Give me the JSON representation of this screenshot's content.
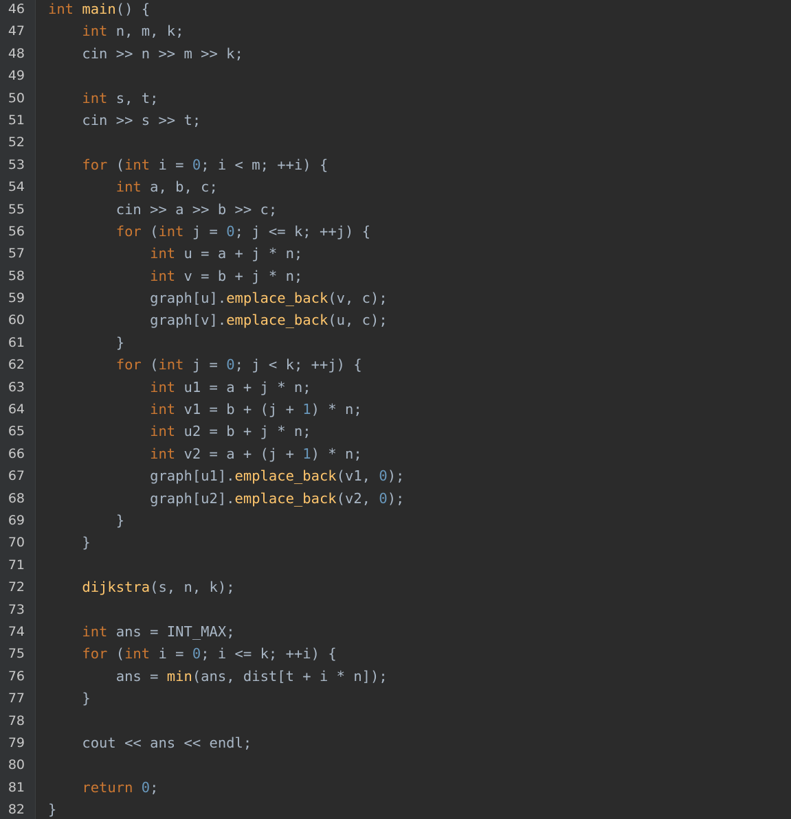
{
  "colors": {
    "background": "#2b2b2b",
    "keyword": "#cc7832",
    "function": "#ffc66d",
    "number": "#6897bb",
    "text": "#a9b7c6",
    "line_number": "#c8c8c8"
  },
  "lines": [
    {
      "n": "46",
      "tokens": [
        {
          "t": "int",
          "c": "kw"
        },
        {
          "t": " ",
          "c": "plain"
        },
        {
          "t": "main",
          "c": "fn"
        },
        {
          "t": "() {",
          "c": "plain"
        }
      ]
    },
    {
      "n": "47",
      "tokens": [
        {
          "t": "    ",
          "c": "plain"
        },
        {
          "t": "int",
          "c": "kw"
        },
        {
          "t": " n, m, k;",
          "c": "plain"
        }
      ]
    },
    {
      "n": "48",
      "tokens": [
        {
          "t": "    cin >> n >> m >> k;",
          "c": "plain"
        }
      ]
    },
    {
      "n": "49",
      "tokens": []
    },
    {
      "n": "50",
      "tokens": [
        {
          "t": "    ",
          "c": "plain"
        },
        {
          "t": "int",
          "c": "kw"
        },
        {
          "t": " s, t;",
          "c": "plain"
        }
      ]
    },
    {
      "n": "51",
      "tokens": [
        {
          "t": "    cin >> s >> t;",
          "c": "plain"
        }
      ]
    },
    {
      "n": "52",
      "tokens": []
    },
    {
      "n": "53",
      "tokens": [
        {
          "t": "    ",
          "c": "plain"
        },
        {
          "t": "for",
          "c": "kw"
        },
        {
          "t": " (",
          "c": "plain"
        },
        {
          "t": "int",
          "c": "kw"
        },
        {
          "t": " i = ",
          "c": "plain"
        },
        {
          "t": "0",
          "c": "num"
        },
        {
          "t": "; i < m; ++i) {",
          "c": "plain"
        }
      ]
    },
    {
      "n": "54",
      "tokens": [
        {
          "t": "        ",
          "c": "plain"
        },
        {
          "t": "int",
          "c": "kw"
        },
        {
          "t": " a, b, c;",
          "c": "plain"
        }
      ]
    },
    {
      "n": "55",
      "tokens": [
        {
          "t": "        cin >> a >> b >> c;",
          "c": "plain"
        }
      ]
    },
    {
      "n": "56",
      "tokens": [
        {
          "t": "        ",
          "c": "plain"
        },
        {
          "t": "for",
          "c": "kw"
        },
        {
          "t": " (",
          "c": "plain"
        },
        {
          "t": "int",
          "c": "kw"
        },
        {
          "t": " j = ",
          "c": "plain"
        },
        {
          "t": "0",
          "c": "num"
        },
        {
          "t": "; j <= k; ++j) {",
          "c": "plain"
        }
      ]
    },
    {
      "n": "57",
      "tokens": [
        {
          "t": "            ",
          "c": "plain"
        },
        {
          "t": "int",
          "c": "kw"
        },
        {
          "t": " u = a + j * n;",
          "c": "plain"
        }
      ]
    },
    {
      "n": "58",
      "tokens": [
        {
          "t": "            ",
          "c": "plain"
        },
        {
          "t": "int",
          "c": "kw"
        },
        {
          "t": " v = b + j * n;",
          "c": "plain"
        }
      ]
    },
    {
      "n": "59",
      "tokens": [
        {
          "t": "            graph[u].",
          "c": "plain"
        },
        {
          "t": "emplace_back",
          "c": "fn"
        },
        {
          "t": "(v, c);",
          "c": "plain"
        }
      ]
    },
    {
      "n": "60",
      "tokens": [
        {
          "t": "            graph[v].",
          "c": "plain"
        },
        {
          "t": "emplace_back",
          "c": "fn"
        },
        {
          "t": "(u, c);",
          "c": "plain"
        }
      ]
    },
    {
      "n": "61",
      "tokens": [
        {
          "t": "        }",
          "c": "plain"
        }
      ]
    },
    {
      "n": "62",
      "tokens": [
        {
          "t": "        ",
          "c": "plain"
        },
        {
          "t": "for",
          "c": "kw"
        },
        {
          "t": " (",
          "c": "plain"
        },
        {
          "t": "int",
          "c": "kw"
        },
        {
          "t": " j = ",
          "c": "plain"
        },
        {
          "t": "0",
          "c": "num"
        },
        {
          "t": "; j < k; ++j) {",
          "c": "plain"
        }
      ]
    },
    {
      "n": "63",
      "tokens": [
        {
          "t": "            ",
          "c": "plain"
        },
        {
          "t": "int",
          "c": "kw"
        },
        {
          "t": " u1 = a + j * n;",
          "c": "plain"
        }
      ]
    },
    {
      "n": "64",
      "tokens": [
        {
          "t": "            ",
          "c": "plain"
        },
        {
          "t": "int",
          "c": "kw"
        },
        {
          "t": " v1 = b + (j + ",
          "c": "plain"
        },
        {
          "t": "1",
          "c": "num"
        },
        {
          "t": ") * n;",
          "c": "plain"
        }
      ]
    },
    {
      "n": "65",
      "tokens": [
        {
          "t": "            ",
          "c": "plain"
        },
        {
          "t": "int",
          "c": "kw"
        },
        {
          "t": " u2 = b + j * n;",
          "c": "plain"
        }
      ]
    },
    {
      "n": "66",
      "tokens": [
        {
          "t": "            ",
          "c": "plain"
        },
        {
          "t": "int",
          "c": "kw"
        },
        {
          "t": " v2 = a + (j + ",
          "c": "plain"
        },
        {
          "t": "1",
          "c": "num"
        },
        {
          "t": ") * n;",
          "c": "plain"
        }
      ]
    },
    {
      "n": "67",
      "tokens": [
        {
          "t": "            graph[u1].",
          "c": "plain"
        },
        {
          "t": "emplace_back",
          "c": "fn"
        },
        {
          "t": "(v1, ",
          "c": "plain"
        },
        {
          "t": "0",
          "c": "num"
        },
        {
          "t": ");",
          "c": "plain"
        }
      ]
    },
    {
      "n": "68",
      "tokens": [
        {
          "t": "            graph[u2].",
          "c": "plain"
        },
        {
          "t": "emplace_back",
          "c": "fn"
        },
        {
          "t": "(v2, ",
          "c": "plain"
        },
        {
          "t": "0",
          "c": "num"
        },
        {
          "t": ");",
          "c": "plain"
        }
      ]
    },
    {
      "n": "69",
      "tokens": [
        {
          "t": "        }",
          "c": "plain"
        }
      ]
    },
    {
      "n": "70",
      "tokens": [
        {
          "t": "    }",
          "c": "plain"
        }
      ]
    },
    {
      "n": "71",
      "tokens": []
    },
    {
      "n": "72",
      "tokens": [
        {
          "t": "    ",
          "c": "plain"
        },
        {
          "t": "dijkstra",
          "c": "fn"
        },
        {
          "t": "(s, n, k);",
          "c": "plain"
        }
      ]
    },
    {
      "n": "73",
      "tokens": []
    },
    {
      "n": "74",
      "tokens": [
        {
          "t": "    ",
          "c": "plain"
        },
        {
          "t": "int",
          "c": "kw"
        },
        {
          "t": " ans = INT_MAX;",
          "c": "plain"
        }
      ]
    },
    {
      "n": "75",
      "tokens": [
        {
          "t": "    ",
          "c": "plain"
        },
        {
          "t": "for",
          "c": "kw"
        },
        {
          "t": " (",
          "c": "plain"
        },
        {
          "t": "int",
          "c": "kw"
        },
        {
          "t": " i = ",
          "c": "plain"
        },
        {
          "t": "0",
          "c": "num"
        },
        {
          "t": "; i <= k; ++i) {",
          "c": "plain"
        }
      ]
    },
    {
      "n": "76",
      "tokens": [
        {
          "t": "        ans = ",
          "c": "plain"
        },
        {
          "t": "min",
          "c": "fn"
        },
        {
          "t": "(ans, dist[t + i * n]);",
          "c": "plain"
        }
      ]
    },
    {
      "n": "77",
      "tokens": [
        {
          "t": "    }",
          "c": "plain"
        }
      ]
    },
    {
      "n": "78",
      "tokens": []
    },
    {
      "n": "79",
      "tokens": [
        {
          "t": "    cout << ans << endl;",
          "c": "plain"
        }
      ]
    },
    {
      "n": "80",
      "tokens": []
    },
    {
      "n": "81",
      "tokens": [
        {
          "t": "    ",
          "c": "plain"
        },
        {
          "t": "return",
          "c": "kw"
        },
        {
          "t": " ",
          "c": "plain"
        },
        {
          "t": "0",
          "c": "num"
        },
        {
          "t": ";",
          "c": "plain"
        }
      ]
    },
    {
      "n": "82",
      "tokens": [
        {
          "t": "}",
          "c": "plain"
        }
      ]
    }
  ]
}
